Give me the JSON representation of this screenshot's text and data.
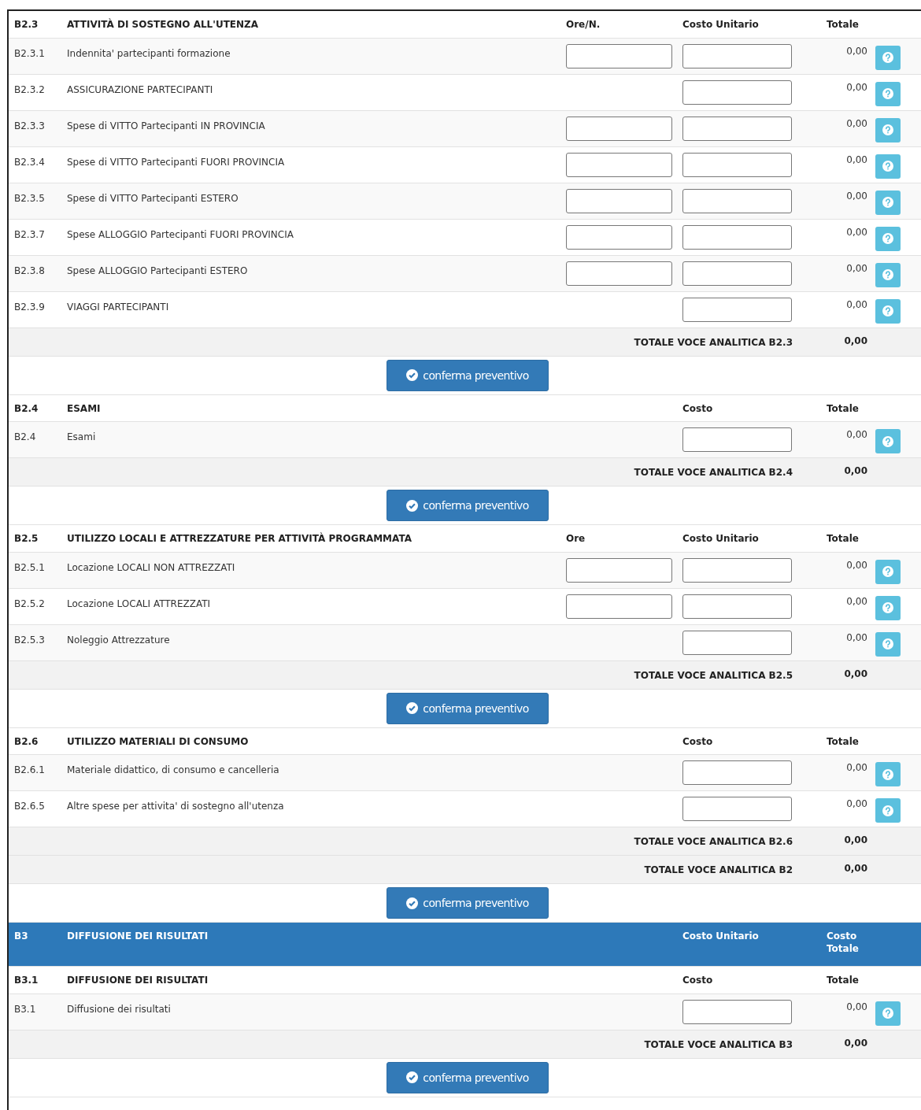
{
  "sections": [
    {
      "kind": "section",
      "code": "B2.3",
      "title": "ATTIVITÀ DI SOSTEGNO ALL'UTENZA",
      "columns": [
        {
          "kind": "qty",
          "label": "Ore/N."
        },
        {
          "kind": "cost",
          "label": "Costo Unitario"
        },
        {
          "kind": "total",
          "label": "Totale"
        }
      ],
      "rows": [
        {
          "code": "B2.3.1",
          "label": "Indennita' partecipanti formazione",
          "has_qty_field": true,
          "has_cost_field": true,
          "total": "0,00"
        },
        {
          "code": "B2.3.2",
          "label": "ASSICURAZIONE PARTECIPANTI",
          "has_qty_field": false,
          "has_cost_field": true,
          "total": "0,00"
        },
        {
          "code": "B2.3.3",
          "label": "Spese di VITTO Partecipanti IN PROVINCIA",
          "has_qty_field": true,
          "has_cost_field": true,
          "total": "0,00"
        },
        {
          "code": "B2.3.4",
          "label": "Spese di VITTO Partecipanti FUORI PROVINCIA",
          "has_qty_field": true,
          "has_cost_field": true,
          "total": "0,00"
        },
        {
          "code": "B2.3.5",
          "label": "Spese di VITTO Partecipanti ESTERO",
          "has_qty_field": true,
          "has_cost_field": true,
          "total": "0,00"
        },
        {
          "code": "B2.3.7",
          "label": "Spese ALLOGGIO Partecipanti FUORI PROVINCIA",
          "has_qty_field": true,
          "has_cost_field": true,
          "total": "0,00"
        },
        {
          "code": "B2.3.8",
          "label": "Spese ALLOGGIO Partecipanti ESTERO",
          "has_qty_field": true,
          "has_cost_field": true,
          "total": "0,00"
        },
        {
          "code": "B2.3.9",
          "label": "VIAGGI PARTECIPANTI",
          "has_qty_field": false,
          "has_cost_field": true,
          "total": "0,00"
        }
      ],
      "totals": [
        {
          "label": "TOTALE VOCE ANALITICA B2.3",
          "value": "0,00"
        }
      ],
      "button": "conferma preventivo"
    },
    {
      "kind": "section",
      "code": "B2.4",
      "title": "ESAMI",
      "columns": [
        {
          "kind": "cost",
          "label": "Costo"
        },
        {
          "kind": "total",
          "label": "Totale"
        }
      ],
      "rows": [
        {
          "code": "B2.4",
          "label": "Esami",
          "has_qty_field": false,
          "has_cost_field": true,
          "total": "0,00"
        }
      ],
      "totals": [
        {
          "label": "TOTALE VOCE ANALITICA B2.4",
          "value": "0,00"
        }
      ],
      "button": "conferma preventivo"
    },
    {
      "kind": "section",
      "code": "B2.5",
      "title": "UTILIZZO LOCALI E ATTREZZATURE PER ATTIVITÀ PROGRAMMATA",
      "columns": [
        {
          "kind": "qty",
          "label": "Ore"
        },
        {
          "kind": "cost",
          "label": "Costo Unitario"
        },
        {
          "kind": "total",
          "label": "Totale"
        }
      ],
      "rows": [
        {
          "code": "B2.5.1",
          "label": "Locazione LOCALI NON ATTREZZATI",
          "has_qty_field": true,
          "has_cost_field": true,
          "total": "0,00"
        },
        {
          "code": "B2.5.2",
          "label": "Locazione LOCALI ATTREZZATI",
          "has_qty_field": true,
          "has_cost_field": true,
          "total": "0,00"
        },
        {
          "code": "B2.5.3",
          "label": "Noleggio Attrezzature",
          "has_qty_field": false,
          "has_cost_field": true,
          "total": "0,00"
        }
      ],
      "totals": [
        {
          "label": "TOTALE VOCE ANALITICA B2.5",
          "value": "0,00"
        }
      ],
      "button": "conferma preventivo"
    },
    {
      "kind": "section",
      "code": "B2.6",
      "title": "UTILIZZO MATERIALI DI CONSUMO",
      "columns": [
        {
          "kind": "cost",
          "label": "Costo"
        },
        {
          "kind": "total",
          "label": "Totale"
        }
      ],
      "rows": [
        {
          "code": "B2.6.1",
          "label": "Materiale didattico, di consumo e cancelleria",
          "has_qty_field": false,
          "has_cost_field": true,
          "total": "0,00"
        },
        {
          "code": "B2.6.5",
          "label": "Altre spese per attivita' di sostegno all'utenza",
          "has_qty_field": false,
          "has_cost_field": true,
          "total": "0,00"
        }
      ],
      "totals": [
        {
          "label": "TOTALE VOCE ANALITICA B2.6",
          "value": "0,00"
        },
        {
          "label": "TOTALE VOCE ANALITICA B2",
          "value": "0,00"
        }
      ],
      "button": "conferma preventivo"
    },
    {
      "kind": "group",
      "code": "B3",
      "title": "DIFFUSIONE DEI RISULTATI",
      "columns": [
        {
          "kind": "cost",
          "label": "Costo Unitario"
        },
        {
          "kind": "total",
          "label": "Costo Totale"
        }
      ]
    },
    {
      "kind": "section",
      "code": "B3.1",
      "title": "DIFFUSIONE DEI RISULTATI",
      "columns": [
        {
          "kind": "cost",
          "label": "Costo"
        },
        {
          "kind": "total",
          "label": "Totale"
        }
      ],
      "rows": [
        {
          "code": "B3.1",
          "label": "Diffusione dei risultati",
          "has_qty_field": false,
          "has_cost_field": true,
          "total": "0,00"
        }
      ],
      "totals": [
        {
          "label": "TOTALE VOCE ANALITICA B3",
          "value": "0,00"
        }
      ],
      "button": "conferma preventivo"
    }
  ]
}
